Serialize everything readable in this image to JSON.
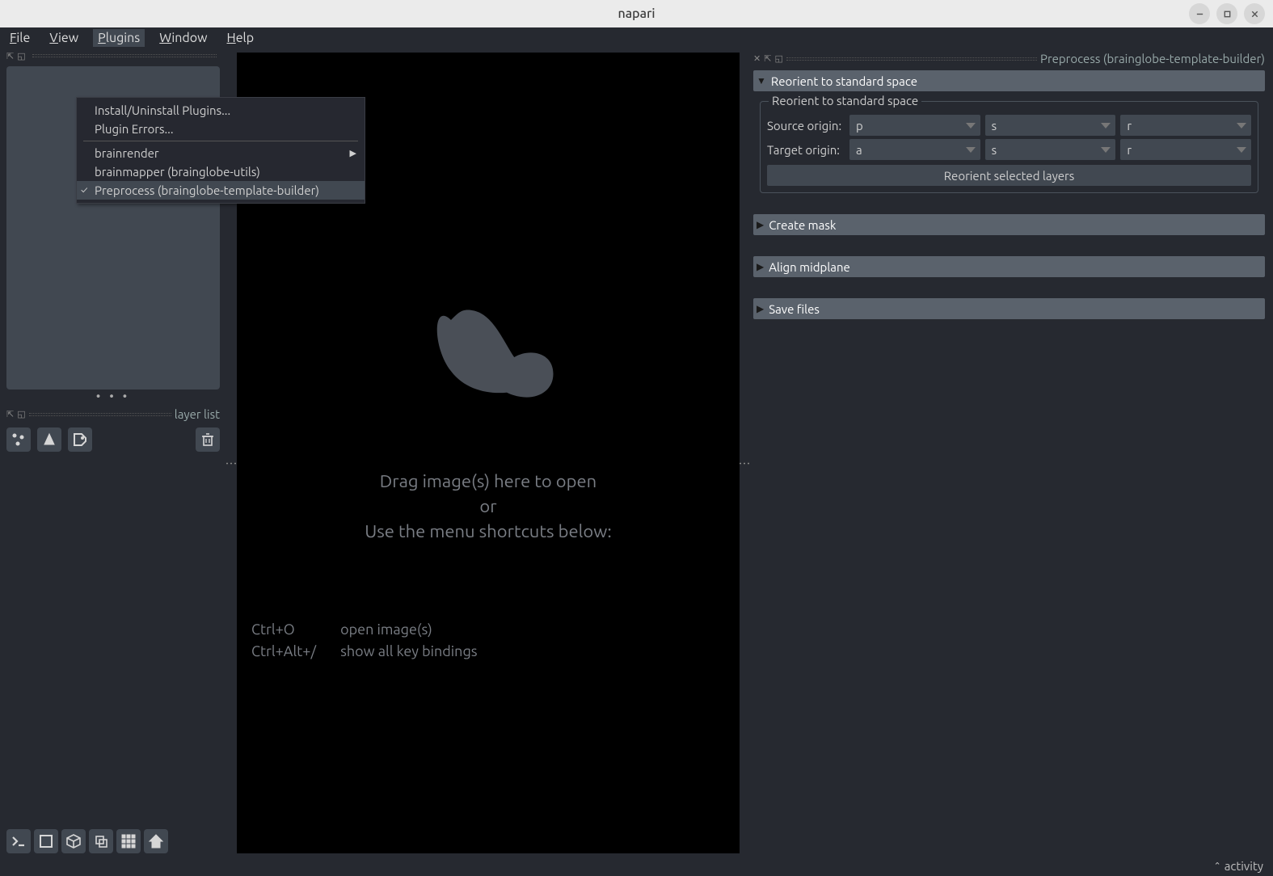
{
  "window": {
    "title": "napari"
  },
  "menubar": {
    "file": "File",
    "view": "View",
    "plugins": "Plugins",
    "window": "Window",
    "help": "Help"
  },
  "plugins_menu": {
    "install": "Install/Uninstall Plugins...",
    "errors": "Plugin Errors...",
    "brainrender": "brainrender",
    "brainmapper": "brainmapper (brainglobe-utils)",
    "preprocess": "Preprocess (brainglobe-template-builder)"
  },
  "left": {
    "layer_list_label": "layer list",
    "dots": "• • •"
  },
  "canvas": {
    "line1": "Drag image(s) here to open",
    "line2": "or",
    "line3": "Use the menu shortcuts below:",
    "shortcut1_keys": "Ctrl+O",
    "shortcut1_desc": "open image(s)",
    "shortcut2_keys": "Ctrl+Alt+/",
    "shortcut2_desc": "show all key bindings"
  },
  "right": {
    "dock_title": "Preprocess (brainglobe-template-builder)",
    "reorient": {
      "header": "Reorient to standard space",
      "group_title": "Reorient to standard space",
      "source_label": "Source origin:",
      "target_label": "Target origin:",
      "source": {
        "a": "p",
        "b": "s",
        "c": "r"
      },
      "target": {
        "a": "a",
        "b": "s",
        "c": "r"
      },
      "button": "Reorient selected layers"
    },
    "create_mask": "Create mask",
    "align": "Align midplane",
    "save": "Save files"
  },
  "activity": {
    "label": "activity"
  }
}
